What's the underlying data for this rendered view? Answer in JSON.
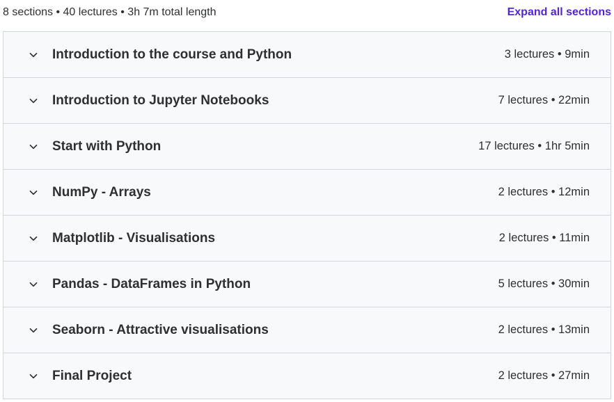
{
  "header": {
    "summary": "8 sections • 40 lectures • 3h 7m total length",
    "expand_label": "Expand all sections"
  },
  "colors": {
    "link": "#5624d0",
    "row_background": "#f7f9fa",
    "border": "#d1d7dc",
    "text": "#2d2f31"
  },
  "sections": [
    {
      "title": "Introduction to the course and Python",
      "meta": "3 lectures • 9min",
      "icon": "chevron-down-icon"
    },
    {
      "title": "Introduction to Jupyter Notebooks",
      "meta": "7 lectures • 22min",
      "icon": "chevron-down-icon"
    },
    {
      "title": "Start with Python",
      "meta": "17 lectures • 1hr 5min",
      "icon": "chevron-down-icon"
    },
    {
      "title": "NumPy - Arrays",
      "meta": "2 lectures • 12min",
      "icon": "chevron-down-icon"
    },
    {
      "title": "Matplotlib - Visualisations",
      "meta": "2 lectures • 11min",
      "icon": "chevron-down-icon"
    },
    {
      "title": "Pandas - DataFrames in Python",
      "meta": "5 lectures • 30min",
      "icon": "chevron-down-icon"
    },
    {
      "title": "Seaborn - Attractive visualisations",
      "meta": "2 lectures • 13min",
      "icon": "chevron-down-icon"
    },
    {
      "title": "Final Project",
      "meta": "2 lectures • 27min",
      "icon": "chevron-down-icon"
    }
  ]
}
